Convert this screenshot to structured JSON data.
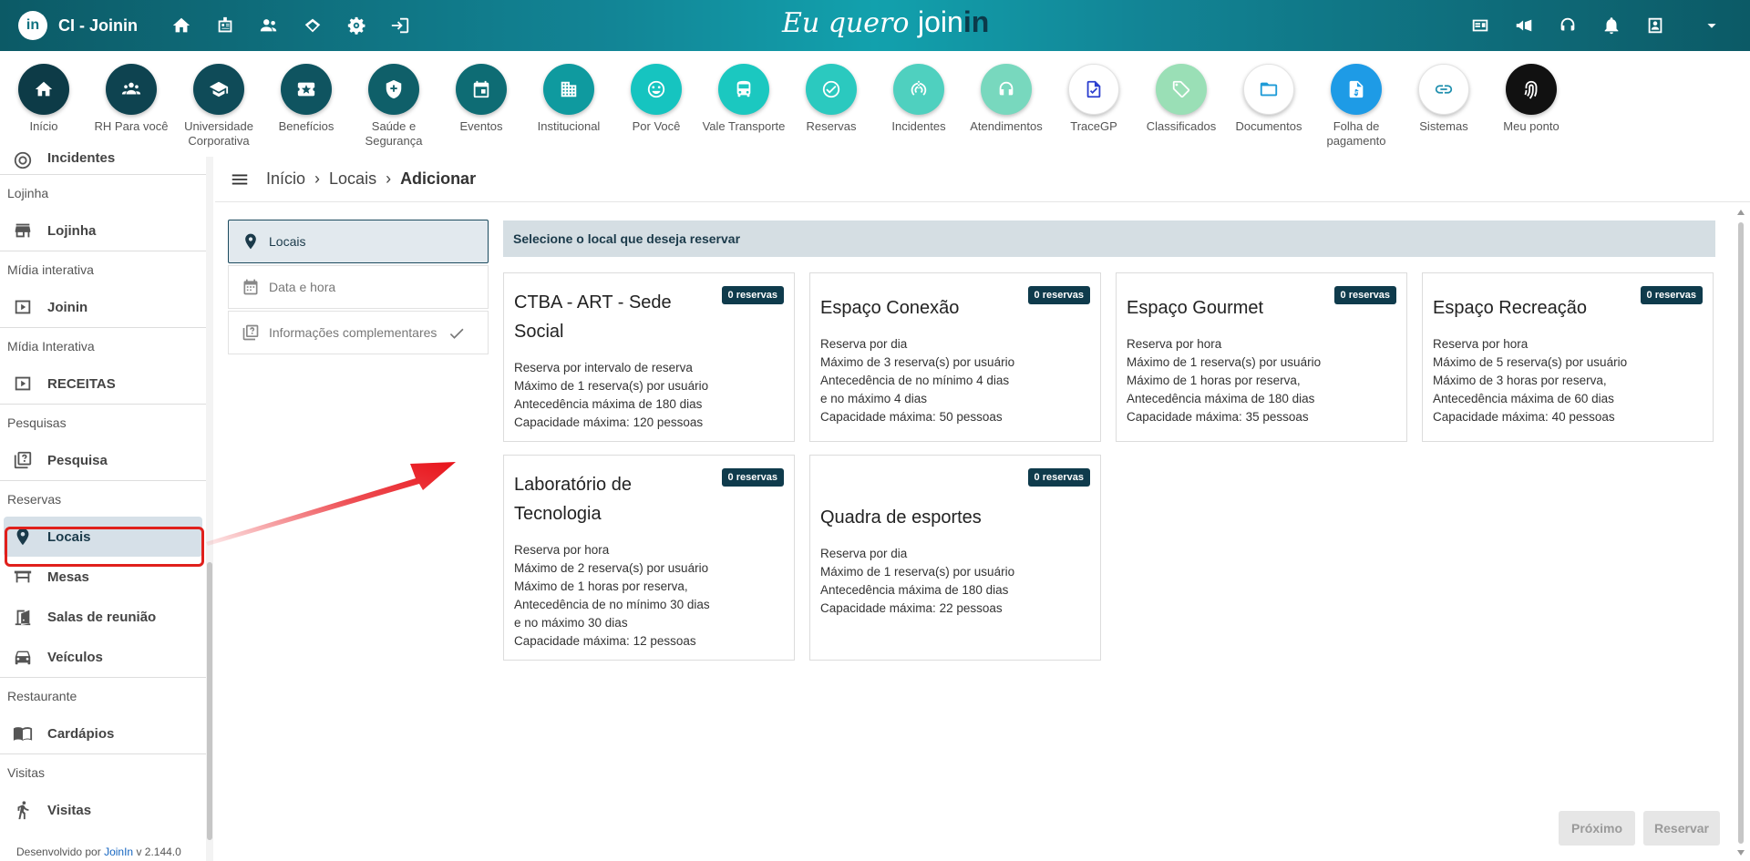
{
  "topbar": {
    "logo_text": "in",
    "title": "CI - Joinin",
    "brand_part1": "Eu quero",
    "brand_part2": "join",
    "brand_part3": "in",
    "left_icons": [
      "home-icon",
      "badge-icon",
      "users-icon",
      "handshake-icon",
      "gear-icon",
      "login-icon"
    ],
    "right_icons": [
      "card-icon",
      "megaphone-icon",
      "headset-icon",
      "bell-icon",
      "profile-icon",
      "caret-down-icon"
    ]
  },
  "modules": [
    {
      "label": "Início",
      "icon": "home-icon",
      "bg": "#0d3b47",
      "fg": "#ffffff"
    },
    {
      "label": "RH Para você",
      "icon": "group-icon",
      "bg": "#0e4350",
      "fg": "#ffffff"
    },
    {
      "label": "Universidade Corporativa",
      "icon": "graduation-icon",
      "bg": "#0f4b58",
      "fg": "#ffffff"
    },
    {
      "label": "Benefícios",
      "icon": "ticket-icon",
      "bg": "#0f5460",
      "fg": "#ffffff"
    },
    {
      "label": "Saúde e Segurança",
      "icon": "shield-icon",
      "bg": "#0f5f69",
      "fg": "#ffffff"
    },
    {
      "label": "Eventos",
      "icon": "calendar-icon",
      "bg": "#0e6c74",
      "fg": "#ffffff"
    },
    {
      "label": "Institucional",
      "icon": "building-icon",
      "bg": "#0f9a9f",
      "fg": "#ffffff"
    },
    {
      "label": "Por Você",
      "icon": "smile-icon",
      "bg": "#16c4c0",
      "fg": "#ffffff"
    },
    {
      "label": "Vale Transporte",
      "icon": "bus-icon",
      "bg": "#1bc8c0",
      "fg": "#ffffff"
    },
    {
      "label": "Reservas",
      "icon": "check-circle-icon",
      "bg": "#2bc9bf",
      "fg": "#ffffff"
    },
    {
      "label": "Incidentes",
      "icon": "alert-icon",
      "bg": "#4fd0bf",
      "fg": "#ffffff"
    },
    {
      "label": "Atendimentos",
      "icon": "support-icon",
      "bg": "#78d8be",
      "fg": "#ffffff"
    },
    {
      "label": "TraceGP",
      "icon": "document-check-icon",
      "bg": "#ffffff",
      "fg": "#2c3fcf"
    },
    {
      "label": "Classificados",
      "icon": "tag-icon",
      "bg": "#9adfb6",
      "fg": "#ffffff"
    },
    {
      "label": "Documentos",
      "icon": "folder-icon",
      "bg": "#ffffff",
      "fg": "#1e9bd7"
    },
    {
      "label": "Folha de pagamento",
      "icon": "payslip-icon",
      "bg": "#1e9be6",
      "fg": "#ffffff"
    },
    {
      "label": "Sistemas",
      "icon": "link-icon",
      "bg": "#ffffff",
      "fg": "#1f8fae"
    },
    {
      "label": "Meu ponto",
      "icon": "fingerprint-icon",
      "bg": "#111111",
      "fg": "#ffffff"
    }
  ],
  "sidebar": {
    "top_item": "Incidentes",
    "sections": [
      {
        "title": "Lojinha",
        "items": [
          {
            "label": "Lojinha",
            "icon": "store-icon"
          }
        ]
      },
      {
        "title": "Mídia interativa",
        "items": [
          {
            "label": "Joinin",
            "icon": "play-icon"
          }
        ]
      },
      {
        "title": "Mídia Interativa",
        "items": [
          {
            "label": "RECEITAS",
            "icon": "play-icon"
          }
        ]
      },
      {
        "title": "Pesquisas",
        "items": [
          {
            "label": "Pesquisa",
            "icon": "survey-icon"
          }
        ]
      },
      {
        "title": "Reservas",
        "items": [
          {
            "label": "Locais",
            "icon": "location-icon",
            "active": true
          },
          {
            "label": "Mesas",
            "icon": "table-icon"
          },
          {
            "label": "Salas de reunião",
            "icon": "door-icon"
          },
          {
            "label": "Veículos",
            "icon": "car-icon"
          }
        ]
      },
      {
        "title": "Restaurante",
        "items": [
          {
            "label": "Cardápios",
            "icon": "menu-book-icon"
          }
        ]
      },
      {
        "title": "Visitas",
        "items": [
          {
            "label": "Visitas",
            "icon": "visitor-icon"
          }
        ]
      }
    ],
    "footer_prefix": "Desenvolvido por",
    "footer_link": "JoinIn",
    "footer_version": "v 2.144.0"
  },
  "breadcrumb": {
    "items": [
      "Início",
      "Locais",
      "Adicionar"
    ]
  },
  "steps": [
    {
      "label": "Locais",
      "icon": "location-icon",
      "active": true
    },
    {
      "label": "Data e hora",
      "icon": "calendar-icon"
    },
    {
      "label": "Informações complementares",
      "icon": "survey-icon",
      "check": true
    }
  ],
  "prompt": "Selecione o local que deseja reservar",
  "cards": [
    {
      "title": "CTBA - ART - Sede Social",
      "badge": "0 reservas",
      "lines": [
        "Reserva por intervalo de reserva",
        "Máximo de 1 reserva(s) por usuário",
        "Antecedência máxima de 180 dias",
        "Capacidade máxima: 120 pessoas"
      ]
    },
    {
      "title": "Espaço Conexão",
      "badge": "0 reservas",
      "lines": [
        "Reserva por dia",
        "Máximo de 3 reserva(s) por usuário",
        "Antecedência de no mínimo 4 dias",
        "e no máximo 4 dias",
        "Capacidade máxima: 50 pessoas"
      ]
    },
    {
      "title": "Espaço Gourmet",
      "badge": "0 reservas",
      "lines": [
        "Reserva por hora",
        "Máximo de 1 reserva(s) por usuário",
        "Máximo de 1 horas por reserva,",
        "Antecedência máxima de 180 dias",
        "Capacidade máxima: 35 pessoas"
      ]
    },
    {
      "title": "Espaço Recreação",
      "badge": "0 reservas",
      "lines": [
        "Reserva por hora",
        "Máximo de 5 reserva(s) por usuário",
        "Máximo de 3 horas por reserva,",
        "Antecedência máxima de 60 dias",
        "Capacidade máxima: 40 pessoas"
      ]
    },
    {
      "title": "Laboratório de Tecnologia",
      "badge": "0 reservas",
      "lines": [
        "Reserva por hora",
        "Máximo de 2 reserva(s) por usuário",
        "Máximo de 1 horas por reserva,",
        "Antecedência de no mínimo 30 dias",
        "e no máximo 30 dias",
        "Capacidade máxima: 12 pessoas"
      ]
    },
    {
      "title": "Quadra de esportes",
      "badge": "0 reservas",
      "lines": [
        "Reserva por dia",
        "Máximo de 1 reserva(s) por usuário",
        "Antecedência máxima de 180 dias",
        "Capacidade máxima: 22 pessoas"
      ]
    }
  ],
  "buttons": {
    "next": "Próximo",
    "reserve": "Reservar"
  },
  "colors": {
    "accent_dark": "#0f3b4c",
    "highlight": "#e0201c",
    "annotation_arrow": "#e8141b"
  }
}
